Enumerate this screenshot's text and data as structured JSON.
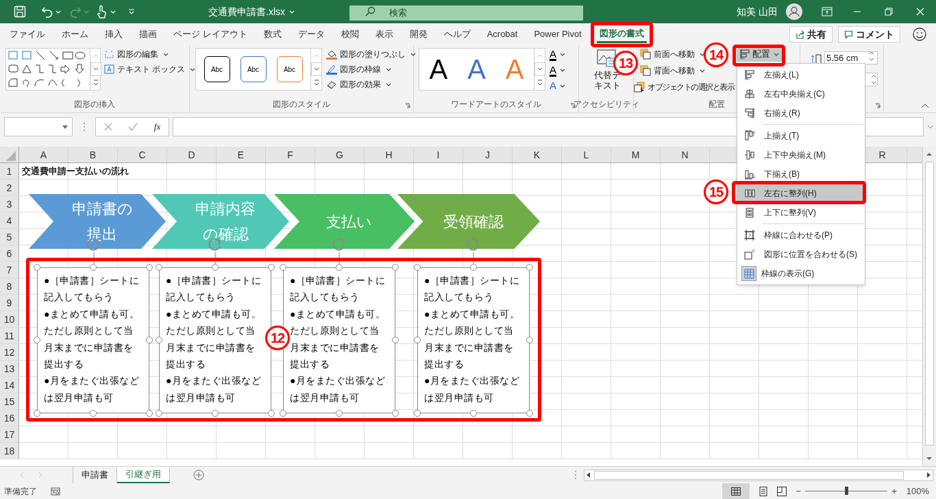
{
  "title_bar": {
    "file_name": "交通費申請書.xlsx",
    "search_placeholder": "検索",
    "user_name": "知美 山田"
  },
  "ribbon_tabs": [
    {
      "label": "ファイル",
      "selected": false
    },
    {
      "label": "ホーム",
      "selected": false
    },
    {
      "label": "挿入",
      "selected": false
    },
    {
      "label": "描画",
      "selected": false
    },
    {
      "label": "ページ レイアウト",
      "selected": false
    },
    {
      "label": "数式",
      "selected": false
    },
    {
      "label": "データ",
      "selected": false
    },
    {
      "label": "校閲",
      "selected": false
    },
    {
      "label": "表示",
      "selected": false
    },
    {
      "label": "開発",
      "selected": false
    },
    {
      "label": "ヘルプ",
      "selected": false
    },
    {
      "label": "Acrobat",
      "selected": false
    },
    {
      "label": "Power Pivot",
      "selected": false
    },
    {
      "label": "図形の書式",
      "selected": true
    }
  ],
  "share_button": "共有",
  "comment_button": "コメント",
  "ribbon": {
    "insert_shapes": {
      "label": "図形の挿入",
      "commands": [
        "図形の編集",
        "テキスト ボックス"
      ]
    },
    "shape_styles": {
      "label": "図形のスタイル",
      "presets": [
        {
          "text": "Abc",
          "color": "#000000"
        },
        {
          "text": "Abc",
          "color": "#4472c4"
        },
        {
          "text": "Abc",
          "color": "#ed7d31"
        }
      ],
      "commands": [
        "図形の塗りつぶし",
        "図形の枠線",
        "図形の効果"
      ]
    },
    "wordart_styles": {
      "label": "ワードアートのスタイル",
      "presets": [
        {
          "text": "A",
          "color": "#000000"
        },
        {
          "text": "A",
          "color": "#4472c4"
        },
        {
          "text": "A",
          "color": "#ed7d31"
        }
      ],
      "commands": [
        "A",
        "A",
        "A"
      ]
    },
    "accessibility": {
      "label": "アクセシビリティ",
      "command": "代替テキスト"
    },
    "arrange": {
      "label": "配置",
      "commands": [
        "前面へ移動",
        "背面へ移動",
        "オブジェクトの選択と表示"
      ],
      "align_button": "配置"
    },
    "size": {
      "height": "5.56 cm"
    }
  },
  "formula_bar": {
    "function_button": "fx"
  },
  "sheet": {
    "columns": [
      "A",
      "B",
      "C",
      "D",
      "E",
      "F",
      "G",
      "H",
      "I",
      "J",
      "K",
      "L",
      "M",
      "N",
      "R"
    ],
    "rows": [
      "1",
      "2",
      "3",
      "4",
      "5",
      "6",
      "7",
      "8",
      "9",
      "10",
      "11",
      "12",
      "13",
      "14",
      "15",
      "16",
      "17",
      "18"
    ],
    "a1": "交通費申請ー支払いの流れ"
  },
  "flow_steps": [
    {
      "text": "申請書の提出",
      "color": "#5b9bd5"
    },
    {
      "text": "申請内容の確認",
      "color": "#4fc9b5"
    },
    {
      "text": "支払い",
      "color": "#48bf63"
    },
    {
      "text": "受領確認",
      "color": "#70ad47"
    }
  ],
  "text_boxes": [
    {
      "paragraphs": [
        "●［申請書］シートに記入してもらう",
        "●まとめて申請も可。ただし原則として当月末までに申請書を提出する",
        "●月をまたぐ出張などは翌月申請も可"
      ],
      "selected": true
    },
    {
      "paragraphs": [
        "●［申請書］シートに記入してもらう",
        "●まとめて申請も可。ただし原則として当月末までに申請書を提出する",
        "●月をまたぐ出張などは翌月申請も可"
      ],
      "selected": true
    },
    {
      "paragraphs": [
        "●［申請書］シートに記入してもらう",
        "●まとめて申請も可。ただし原則として当月末までに申請書を提出する",
        "●月をまたぐ出張などは翌月申請も可"
      ],
      "selected": true
    },
    {
      "paragraphs": [
        "●［申請書］シートに記入してもらう",
        "●まとめて申請も可。ただし原則として当月末までに申請書を提出する",
        "●月をまたぐ出張などは翌月申請も可"
      ],
      "selected": true
    }
  ],
  "align_menu": {
    "sections": [
      {
        "items": [
          {
            "label": "左揃え(L)",
            "selected": false,
            "checked": false
          },
          {
            "label": "左右中央揃え(C)",
            "selected": false,
            "checked": false
          },
          {
            "label": "右揃え(R)",
            "selected": false,
            "checked": false
          }
        ]
      },
      {
        "items": [
          {
            "label": "上揃え(T)",
            "selected": false,
            "checked": false
          },
          {
            "label": "上下中央揃え(M)",
            "selected": false,
            "checked": false
          },
          {
            "label": "下揃え(B)",
            "selected": false,
            "checked": false
          },
          {
            "label": "左右に整列(H)",
            "selected": true,
            "checked": false
          },
          {
            "label": "上下に整列(V)",
            "selected": false,
            "checked": false
          }
        ]
      },
      {
        "items": [
          {
            "label": "枠線に合わせる(P)",
            "selected": false,
            "checked": false
          },
          {
            "label": "図形に位置を合わせる(S)",
            "selected": false,
            "checked": false
          },
          {
            "label": "枠線の表示(G)",
            "selected": false,
            "checked": true
          }
        ]
      }
    ]
  },
  "annotation_markers": [
    "12",
    "13",
    "14",
    "15"
  ],
  "sheet_tabs": [
    {
      "label": "申請書",
      "selected": false
    },
    {
      "label": "引継ぎ用",
      "selected": true
    }
  ],
  "status_bar": {
    "text": "準備完了",
    "zoom_out": "−",
    "zoom_in": "+",
    "level": 0.5,
    "zoom": "100%"
  }
}
